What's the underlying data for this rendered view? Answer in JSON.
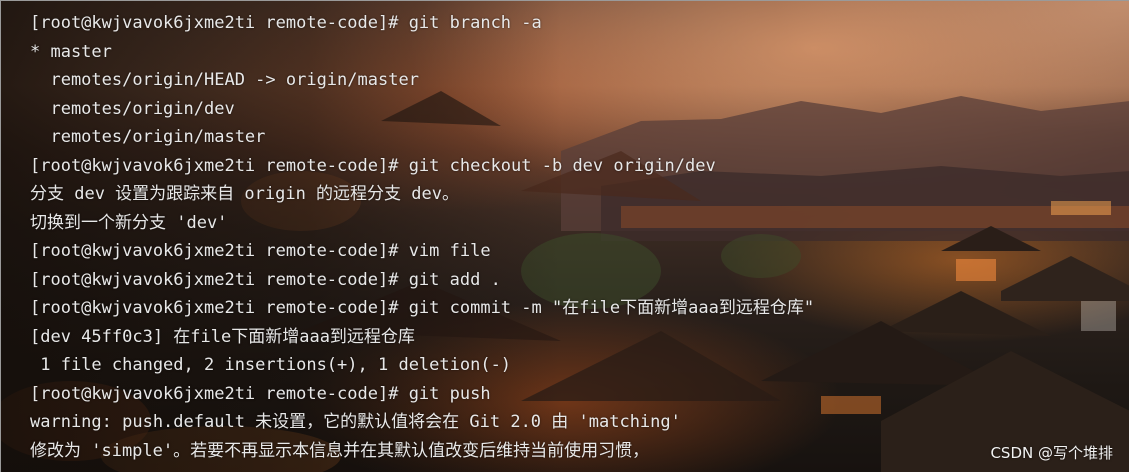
{
  "terminal": {
    "lines": [
      "[root@kwjvavok6jxme2ti remote-code]# git branch -a",
      "* master",
      "  remotes/origin/HEAD -> origin/master",
      "  remotes/origin/dev",
      "  remotes/origin/master",
      "[root@kwjvavok6jxme2ti remote-code]# git checkout -b dev origin/dev",
      "分支 dev 设置为跟踪来自 origin 的远程分支 dev。",
      "切换到一个新分支 'dev'",
      "[root@kwjvavok6jxme2ti remote-code]# vim file",
      "[root@kwjvavok6jxme2ti remote-code]# git add .",
      "[root@kwjvavok6jxme2ti remote-code]# git commit -m \"在file下面新增aaa到远程仓库\"",
      "[dev 45ff0c3] 在file下面新增aaa到远程仓库",
      " 1 file changed, 2 insertions(+), 1 deletion(-)",
      "[root@kwjvavok6jxme2ti remote-code]# git push",
      "warning: push.default 未设置，它的默认值将会在 Git 2.0 由 'matching'",
      "修改为 'simple'。若要不再显示本信息并在其默认值改变后维持当前使用习惯，"
    ]
  },
  "watermark": "CSDN @写个堆排",
  "colors": {
    "text": "#e8e8e8",
    "background_dark": "#1a1410",
    "background_accent": "#e89a5a"
  }
}
